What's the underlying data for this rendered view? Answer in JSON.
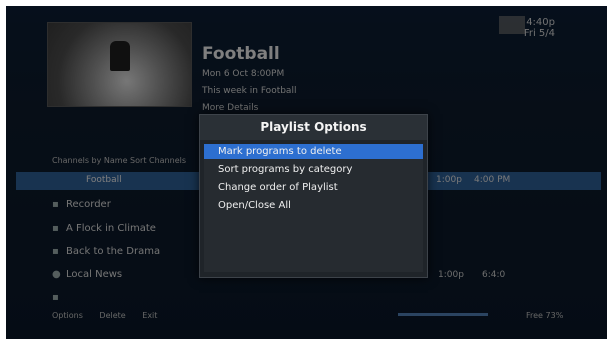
{
  "program": {
    "title": "Football",
    "meta_line1": "Mon 6 Oct 8:00PM",
    "meta_line2": "This week in Football",
    "meta_line3": "More Details",
    "clock": "4:40p",
    "clock_sub": "Fri 5/4"
  },
  "list": {
    "sort_label": "Channels by Name Sort Channels",
    "selected_row": {
      "label": "Football",
      "right1": "1:00p",
      "right2": "4:00 PM"
    },
    "items": [
      {
        "icon": "tv-icon",
        "label": "Recorder"
      },
      {
        "icon": "tv-icon",
        "label": "A Flock in Climate"
      },
      {
        "icon": "tv-icon",
        "label": "Back to the Drama"
      },
      {
        "icon": "dot-icon",
        "label": "Local News",
        "right1": "1:00p",
        "right2": "6:4:0"
      },
      {
        "icon": "tv-icon",
        "label": ""
      }
    ]
  },
  "footer": {
    "left": "Options",
    "btn1": "Delete",
    "btn2": "Exit",
    "right": "Free 73%"
  },
  "dialog": {
    "title": "Playlist Options",
    "options": [
      "Mark programs to delete",
      "Sort programs by category",
      "Change order of Playlist",
      "Open/Close All"
    ],
    "selected_index": 0
  }
}
